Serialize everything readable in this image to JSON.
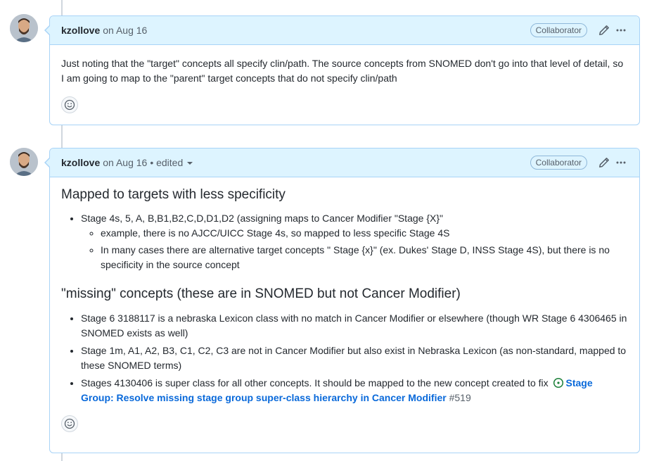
{
  "comments": [
    {
      "author": "kzollove",
      "date": "on Aug 16",
      "badge": "Collaborator",
      "body": "Just noting that the \"target\" concepts all specify clin/path. The source concepts from SNOMED don't go into that level of detail, so I am going to map to the \"parent\" target concepts that do not specify clin/path"
    },
    {
      "author": "kzollove",
      "date": "on Aug 16",
      "edited": "• edited",
      "badge": "Collaborator",
      "heading1": "Mapped to targets with less specificity",
      "list1_item": "Stage 4s, 5, A, B,B1,B2,C,D,D1,D2 (assigning maps to Cancer Modifier \"Stage {X}\"",
      "list1_sub": [
        "example, there is no AJCC/UICC Stage 4s, so mapped to less specific Stage 4S",
        "In many cases there are alternative target concepts \" Stage {x}\" (ex. Dukes' Stage D, INSS Stage 4S), but there is no specificity in the source concept"
      ],
      "heading2": "\"missing\" concepts (these are in SNOMED but not Cancer Modifier)",
      "list2": [
        "Stage 6 3188117 is a nebraska Lexicon class with no match in Cancer Modifier or elsewhere (though WR Stage 6 4306465 in SNOMED exists as well)",
        "Stage 1m, A1, A2, B3, C1, C2, C3 are not in Cancer Modifier but also exist in Nebraska Lexicon (as non-standard, mapped to these SNOMED terms)"
      ],
      "list2_last_text": "Stages 4130406 is super class for all other concepts. It should be mapped to the new concept created to fix",
      "issue_link": "Stage Group: Resolve missing stage group super-class hierarchy in Cancer Modifier",
      "issue_number": "#519"
    }
  ],
  "icons": [
    "avatar",
    "pencil-icon",
    "kebab-icon",
    "smiley-icon",
    "issue-open-icon",
    "chevron-down-icon"
  ],
  "colors": {
    "header_bg": "#ddf4ff",
    "border": "#a8d3f7",
    "link": "#0969da",
    "issue_green": "#1a7f37"
  }
}
